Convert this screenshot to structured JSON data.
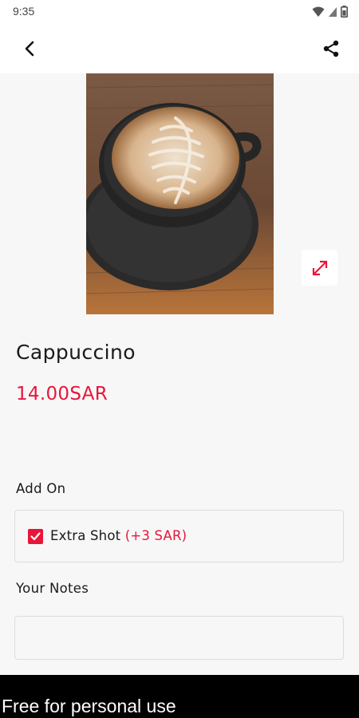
{
  "status_bar": {
    "time": "9:35",
    "icons": [
      "wifi-icon",
      "signal-icon",
      "battery-icon"
    ]
  },
  "app_bar": {
    "back_icon": "back-arrow-icon",
    "share_icon": "share-icon"
  },
  "product": {
    "image": "cappuccino-latte-art-photo",
    "expand_icon": "expand-icon",
    "name": "Cappuccino",
    "price": "14.00SAR"
  },
  "addons": {
    "title": "Add On",
    "items": [
      {
        "label": "Extra Shot",
        "price": "(+3 SAR)",
        "checked": true
      }
    ]
  },
  "notes": {
    "title": "Your Notes",
    "value": "",
    "placeholder": ""
  },
  "watermark": {
    "text": "Free for personal use"
  },
  "colors": {
    "accent": "#e8163a",
    "background": "#f7f7f7",
    "surface": "#ffffff"
  }
}
